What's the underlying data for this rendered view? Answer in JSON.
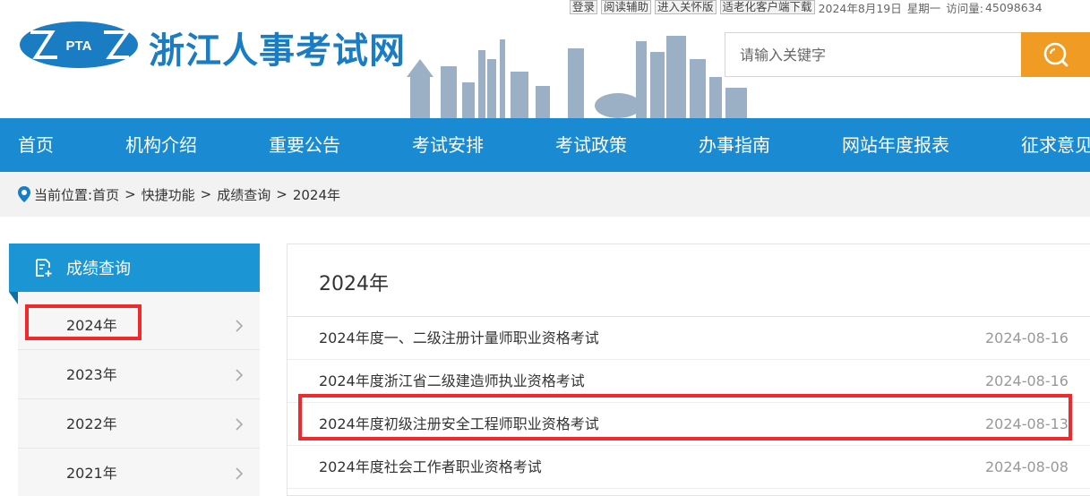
{
  "topbar": {
    "login": "登录",
    "reading_aid": "阅读辅助",
    "care_mode": "进入关怀版",
    "elderly_download": "适老化客户端下载",
    "date": "2024年8月19日",
    "weekday": "星期一",
    "visits_label": "访问量:",
    "visits_value": "45098634"
  },
  "header": {
    "logo_text": "PTA",
    "title": "浙江人事考试网",
    "search_placeholder": "请输入关键字"
  },
  "nav": {
    "items": [
      "首页",
      "机构介绍",
      "重要公告",
      "考试安排",
      "考试政策",
      "办事指南",
      "网站年度报表",
      "征求意见"
    ]
  },
  "breadcrumb": {
    "label": "当前位置:",
    "items": [
      "首页",
      "快捷功能",
      "成绩查询",
      "2024年"
    ],
    "separator": ">"
  },
  "sidebar": {
    "title": "成绩查询",
    "items": [
      "2024年",
      "2023年",
      "2022年",
      "2021年"
    ]
  },
  "main": {
    "title": "2024年",
    "articles": [
      {
        "title": "2024年度一、二级注册计量师职业资格考试",
        "date": "2024-08-16"
      },
      {
        "title": "2024年度浙江省二级建造师执业资格考试",
        "date": "2024-08-16"
      },
      {
        "title": "2024年度初级注册安全工程师职业资格考试",
        "date": "2024-08-13"
      },
      {
        "title": "2024年度社会工作者职业资格考试",
        "date": "2024-08-08"
      }
    ]
  },
  "colors": {
    "brand_blue": "#1a8bd2",
    "title_blue": "#1a7dc4",
    "search_orange": "#ef9b24",
    "highlight_red": "#f0292c"
  }
}
